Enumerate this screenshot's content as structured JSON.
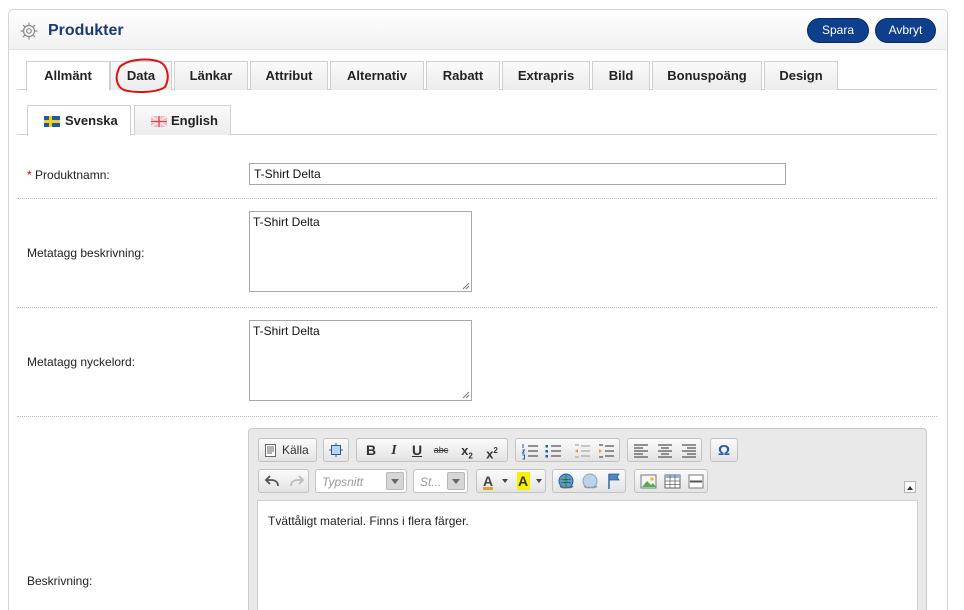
{
  "header": {
    "title": "Produkter",
    "save_label": "Spara",
    "cancel_label": "Avbryt"
  },
  "tabs": [
    {
      "label": "Allmänt",
      "active": true
    },
    {
      "label": "Data",
      "active": false
    },
    {
      "label": "Länkar",
      "active": false
    },
    {
      "label": "Attribut",
      "active": false
    },
    {
      "label": "Alternativ",
      "active": false
    },
    {
      "label": "Rabatt",
      "active": false
    },
    {
      "label": "Extrapris",
      "active": false
    },
    {
      "label": "Bild",
      "active": false
    },
    {
      "label": "Bonuspoäng",
      "active": false
    },
    {
      "label": "Design",
      "active": false
    }
  ],
  "language_tabs": [
    {
      "label": "Svenska",
      "active": true,
      "icon": "flag-sweden-icon"
    },
    {
      "label": "English",
      "active": false,
      "icon": "flag-uk-icon"
    }
  ],
  "form": {
    "product_name": {
      "required_mark": "*",
      "label": "Produktnamn:",
      "value": "T-Shirt Delta"
    },
    "meta_description": {
      "label": "Metatagg beskrivning:",
      "value": "T-Shirt Delta"
    },
    "meta_keywords": {
      "label": "Metatagg nyckelord:",
      "value": "T-Shirt Delta"
    },
    "description": {
      "label": "Beskrivning:",
      "value": "Tvättåligt material. Finns i flera färger."
    }
  },
  "editor": {
    "source_label": "Källa",
    "font_placeholder": "Typsnitt",
    "size_placeholder": "St...",
    "bold": "B",
    "italic": "I",
    "underline": "U",
    "strike": "abc",
    "subscript_base": "x",
    "subscript": "2",
    "superscript_base": "x",
    "superscript": "2",
    "text_color_glyph": "A",
    "bg_color_glyph": "A",
    "special_char_glyph": "Ω"
  },
  "colors": {
    "accent": "#0d3f8c",
    "title": "#1d3b73",
    "annotation": "#e01010"
  }
}
